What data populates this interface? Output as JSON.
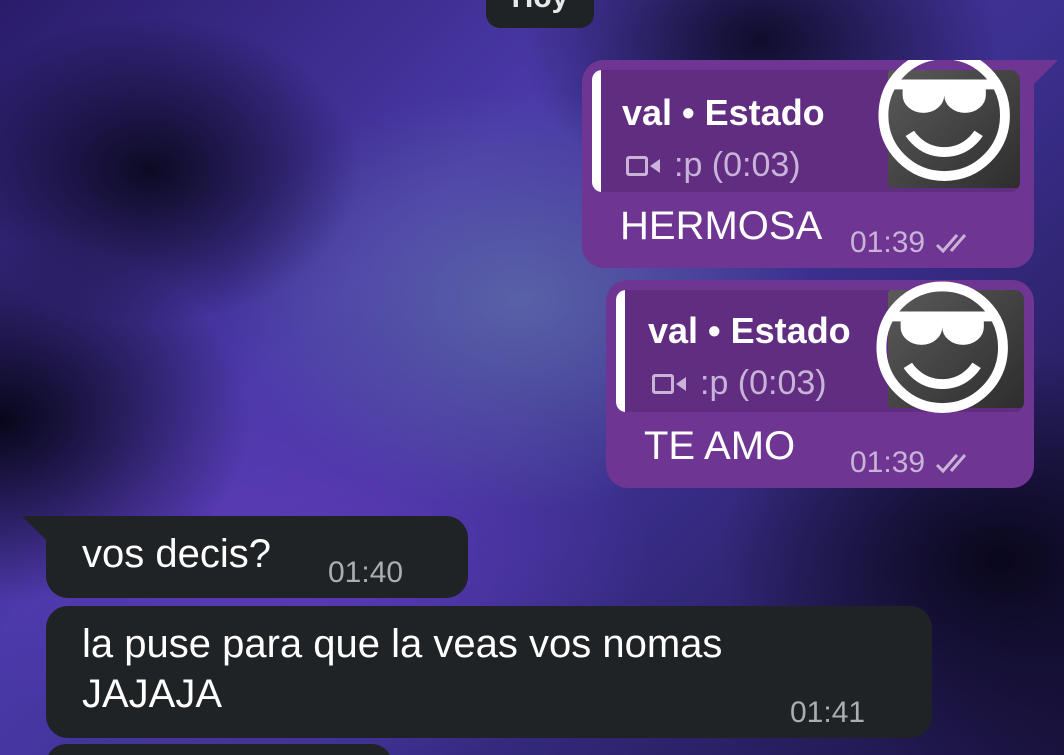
{
  "chat": {
    "date_separator": "Hoy",
    "messages": [
      {
        "direction": "outgoing",
        "reply": {
          "author": "val • Estado",
          "media_icon": "video-icon",
          "media_text": ":p (0:03)",
          "thumbnail_emoji": "😎"
        },
        "text": "HERMOSA",
        "time": "01:39",
        "status_icon": "double-check-icon"
      },
      {
        "direction": "outgoing",
        "reply": {
          "author": "val • Estado",
          "media_icon": "video-icon",
          "media_text": ":p (0:03)",
          "thumbnail_emoji": "😎"
        },
        "text": "TE AMO",
        "time": "01:39",
        "status_icon": "double-check-icon"
      },
      {
        "direction": "incoming",
        "text": "vos decis?",
        "time": "01:40"
      },
      {
        "direction": "incoming",
        "text_line1": "la puse para que la veas vos nomas",
        "text_line2": "JAJAJA",
        "time": "01:41"
      }
    ]
  },
  "colors": {
    "outgoing_bubble": "#6f3592",
    "incoming_bubble": "#1f2326",
    "meta_text": "#c9b3d9"
  }
}
